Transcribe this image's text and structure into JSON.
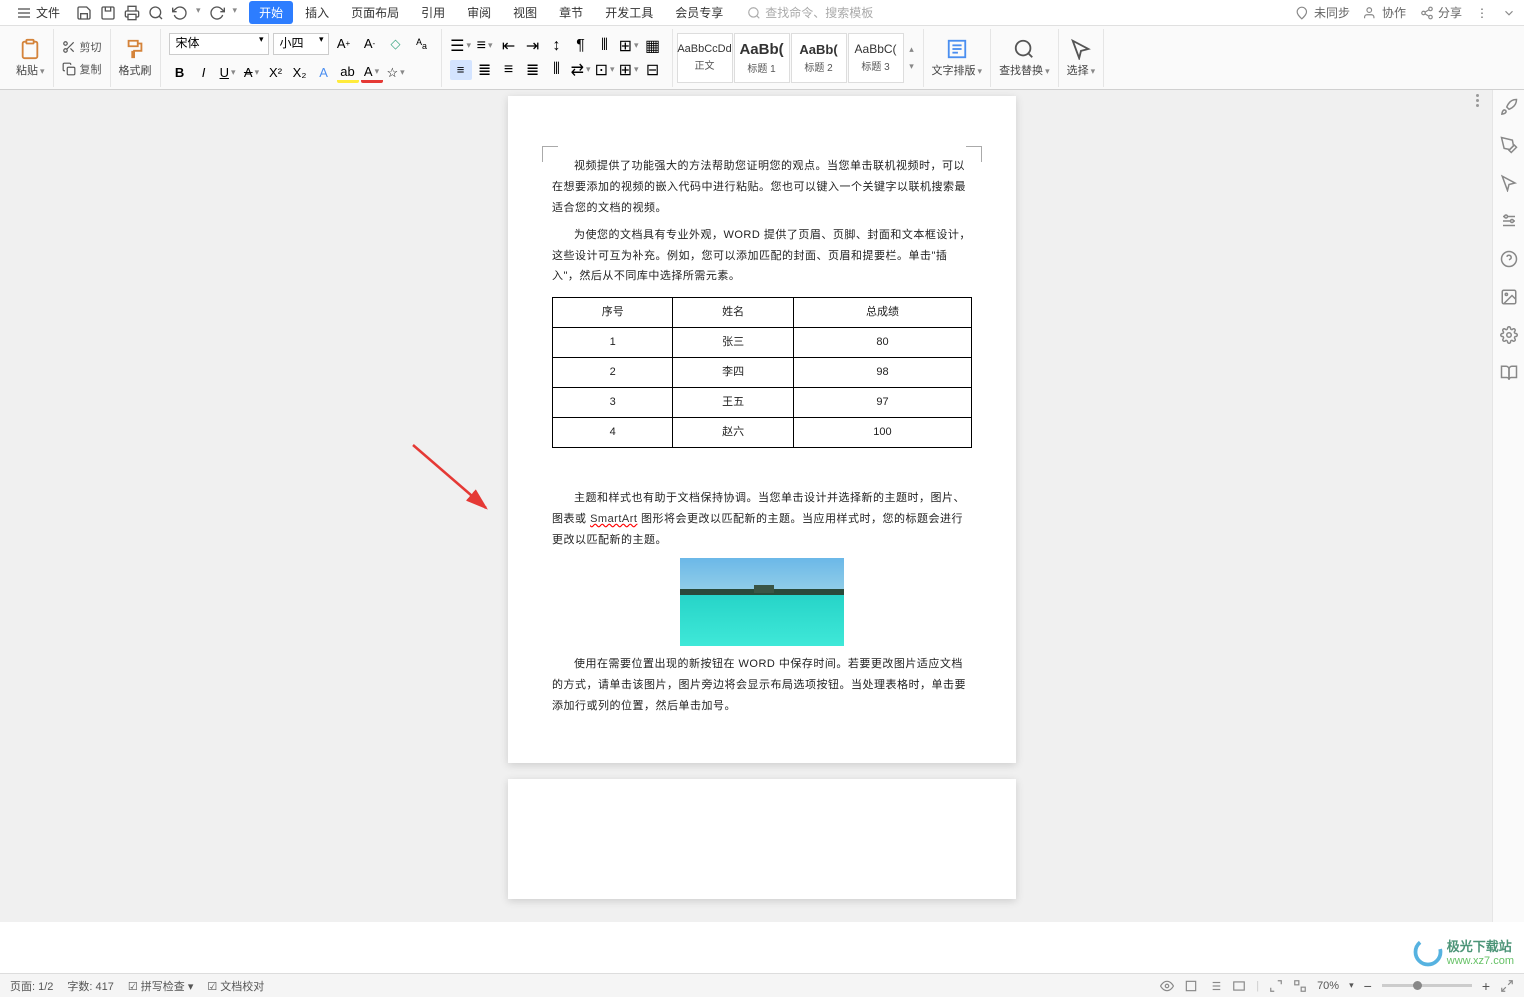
{
  "menu": {
    "file": "文件",
    "tabs": [
      "开始",
      "插入",
      "页面布局",
      "引用",
      "审阅",
      "视图",
      "章节",
      "开发工具",
      "会员专享"
    ],
    "search_placeholder": "查找命令、搜索模板",
    "not_synced": "未同步",
    "collab": "协作",
    "share": "分享"
  },
  "ribbon": {
    "paste": "粘贴",
    "cut": "剪切",
    "copy": "复制",
    "format_painter": "格式刷",
    "font_name": "宋体",
    "font_size": "小四",
    "styles": [
      {
        "preview": "AaBbCcDd",
        "label": "正文"
      },
      {
        "preview": "AaBb(",
        "label": "标题 1"
      },
      {
        "preview": "AaBb(",
        "label": "标题 2"
      },
      {
        "preview": "AaBbC(",
        "label": "标题 3"
      }
    ],
    "text_layout": "文字排版",
    "find_replace": "查找替换",
    "select": "选择"
  },
  "doc": {
    "p1": "视频提供了功能强大的方法帮助您证明您的观点。当您单击联机视频时，可以在想要添加的视频的嵌入代码中进行粘贴。您也可以键入一个关键字以联机搜索最适合您的文档的视频。",
    "p2": "为使您的文档具有专业外观，WORD 提供了页眉、页脚、封面和文本框设计，这些设计可互为补充。例如，您可以添加匹配的封面、页眉和提要栏。单击\"插入\"，然后从不同库中选择所需元素。",
    "table": {
      "headers": [
        "序号",
        "姓名",
        "总成绩"
      ],
      "rows": [
        [
          "1",
          "张三",
          "80"
        ],
        [
          "2",
          "李四",
          "98"
        ],
        [
          "3",
          "王五",
          "97"
        ],
        [
          "4",
          "赵六",
          "100"
        ]
      ]
    },
    "p3a": "主题和样式也有助于文档保持协调。当您单击设计并选择新的主题时，图片、图表或 ",
    "p3_smart": "SmartArt",
    "p3b": " 图形将会更改以匹配新的主题。当应用样式时，您的标题会进行更改以匹配新的主题。",
    "p4": "使用在需要位置出现的新按钮在 WORD 中保存时间。若要更改图片适应文档的方式，请单击该图片，图片旁边将会显示布局选项按钮。当处理表格时，单击要添加行或列的位置，然后单击加号。"
  },
  "status": {
    "page": "页面: 1/2",
    "words": "字数: 417",
    "spellcheck": "拼写检查",
    "proof": "文档校对",
    "zoom": "70%"
  },
  "watermark": {
    "site": "极光下载站",
    "url": "www.xz7.com"
  }
}
